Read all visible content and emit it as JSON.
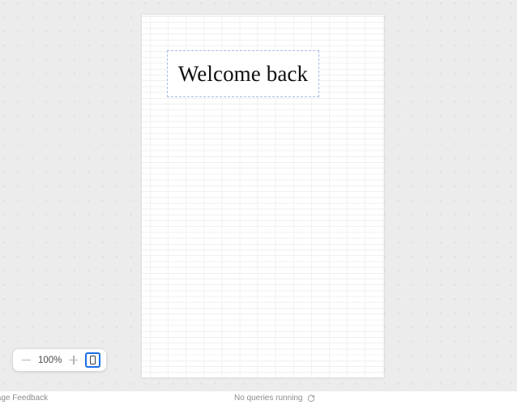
{
  "canvas": {
    "background_color": "#ececec",
    "dot_color": "#dedede"
  },
  "document_page": {
    "background_color": "#ffffff",
    "blocks": [
      {
        "type": "heading",
        "text": "Welcome back",
        "selected": true,
        "selection_border_color": "#a8bde8"
      }
    ]
  },
  "zoom_controls": {
    "zoom_out_label": "−",
    "zoom_level": "100%",
    "zoom_in_label": "+",
    "device_toggle_icon": "mobile-device-icon",
    "device_toggle_active": true,
    "focus_ring_color": "#1a6fe8"
  },
  "status_bar": {
    "left_text": "ltipage Feedback",
    "center_text": "No queries running",
    "refresh_icon": "refresh-icon"
  }
}
